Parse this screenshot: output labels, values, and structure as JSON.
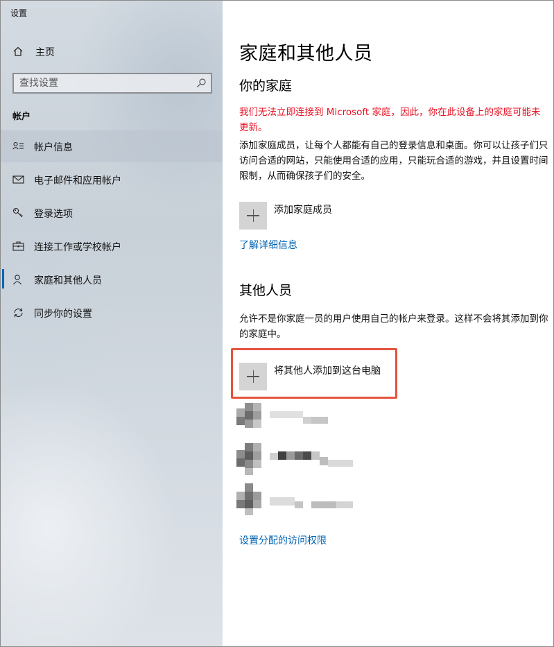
{
  "window": {
    "title": "设置"
  },
  "sidebar": {
    "home_label": "主页",
    "search_placeholder": "查找设置",
    "section_title": "帐户",
    "items": [
      {
        "label": "帐户信息",
        "icon": "account-info-icon",
        "selected": true
      },
      {
        "label": "电子邮件和应用帐户",
        "icon": "mail-icon"
      },
      {
        "label": "登录选项",
        "icon": "key-icon"
      },
      {
        "label": "连接工作或学校帐户",
        "icon": "briefcase-icon"
      },
      {
        "label": "家庭和其他人员",
        "icon": "person-icon",
        "active_indicator": true
      },
      {
        "label": "同步你的设置",
        "icon": "sync-icon"
      }
    ]
  },
  "main": {
    "title": "家庭和其他人员",
    "family": {
      "heading": "你的家庭",
      "warning": "我们无法立即连接到 Microsoft 家庭，因此，你在此设备上的家庭可能未更新。",
      "description": "添加家庭成员，让每个人都能有自己的登录信息和桌面。你可以让孩子们只访问合适的网站，只能使用合适的应用，只能玩合适的游戏，并且设置时间限制，从而确保孩子们的安全。",
      "add_label": "添加家庭成员",
      "learn_more": "了解详细信息"
    },
    "others": {
      "heading": "其他人员",
      "description": "允许不是你家庭一员的用户使用自己的帐户来登录。这样不会将其添加到你的家庭中。",
      "add_label": "将其他人添加到这台电脑",
      "assigned_access": "设置分配的访问权限"
    }
  },
  "colors": {
    "accent": "#0063b1",
    "warning": "#e81123",
    "highlight_box": "#e5533d"
  }
}
